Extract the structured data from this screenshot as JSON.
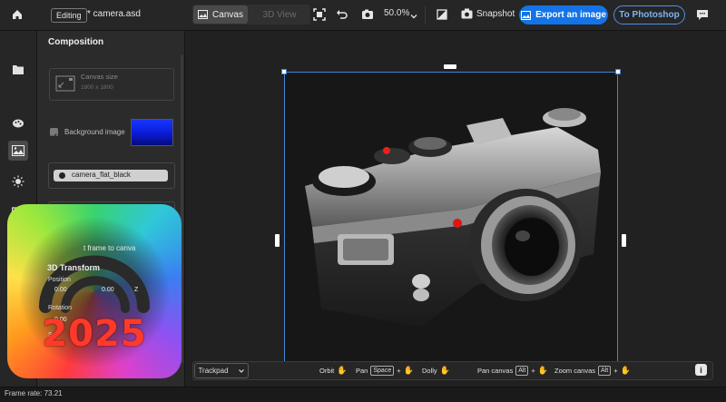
{
  "topbar": {
    "mode_label": "Editing",
    "document_title": "* camera.asd",
    "tabs": [
      {
        "label": "Canvas",
        "active": true
      },
      {
        "label": "3D View",
        "active": false
      }
    ],
    "zoom_level": "50.0%",
    "snapshot_label": "Snapshot",
    "export_label": "Export an image",
    "photoshop_label": "To Photoshop",
    "icons": [
      "home-icon",
      "canvas-icon",
      "fit-icon",
      "undo-icon",
      "render-icon",
      "chevron-down-icon",
      "crop-icon",
      "snapshot-icon",
      "export-icon",
      "chat-icon"
    ]
  },
  "rail": {
    "icons": [
      "folder-icon",
      "materials-icon",
      "environment-icon",
      "light-icon",
      "camera-icon"
    ]
  },
  "panel": {
    "title": "Composition",
    "canvas_size_label": "Canvas size",
    "canvas_size_value": "1800 x 1800",
    "background_image_label": "Background image",
    "background_color": "#1230f0",
    "material_name": "camera_flat_black",
    "fit_text": "t frame to canva",
    "transform_title": "3D Transform",
    "position_label": "Position",
    "position_values": [
      "0.00",
      "0.00"
    ],
    "position_z": "Z",
    "rotation_label": "Rotation",
    "rotation_value": "0.00",
    "scale_label": "Sc"
  },
  "logo": {
    "year": "2025",
    "description_colors": [
      "#ff3b3b",
      "#ffe14a",
      "#38d36e",
      "#3a7ff0",
      "#e040c8"
    ]
  },
  "bottombar": {
    "input_mode": "Trackpad",
    "hints": [
      {
        "label": "Orbit",
        "keys": []
      },
      {
        "label": "Pan",
        "keys": [
          "Space"
        ]
      },
      {
        "label": "Dolly",
        "keys": []
      },
      {
        "label": "Pan canvas",
        "keys": [
          "Alt"
        ]
      },
      {
        "label": "Zoom canvas",
        "keys": [
          "Alt"
        ]
      }
    ],
    "info_label": "i"
  },
  "status": {
    "frame_rate": "Frame rate: 73.21"
  },
  "colors": {
    "accent": "#1473e6",
    "selection": "#3d86d9",
    "panel_bg": "#2b2b2b"
  }
}
